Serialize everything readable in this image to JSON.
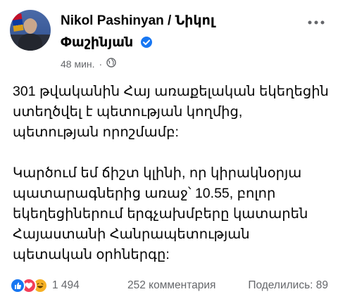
{
  "author": {
    "name_line1": "Nikol Pashinyan / Նիկոլ",
    "name_line2": "Փաշինյան"
  },
  "meta": {
    "time": "48 мин.",
    "separator": "·",
    "audience_icon": "globe-icon"
  },
  "post": {
    "paragraph1": "301 թվականին Հայ առաքելական եկեղեցին ստեղծվել է պետության կողմից, պետության որոշմամբ:",
    "paragraph2": "Կարծում եմ ճիշտ կլինի, որ կիրակնօրյա պատարագներից առաջ՝ 10.55, բոլոր եկեղեցիներում երգչախմբերը կատարեն Հայաստանի Հանրապետության պետական օրհներգը:"
  },
  "stats": {
    "reactions_count": "1 494",
    "comments": "252 комментария",
    "shares": "Поделились: 89",
    "reaction_icons": [
      "like-icon",
      "love-icon",
      "haha-icon"
    ]
  },
  "colors": {
    "text": "#050505",
    "secondary": "#65676b",
    "verified": "#1877f2",
    "like": "#1877f2",
    "love": "#f33e58",
    "haha": "#f7b125"
  }
}
